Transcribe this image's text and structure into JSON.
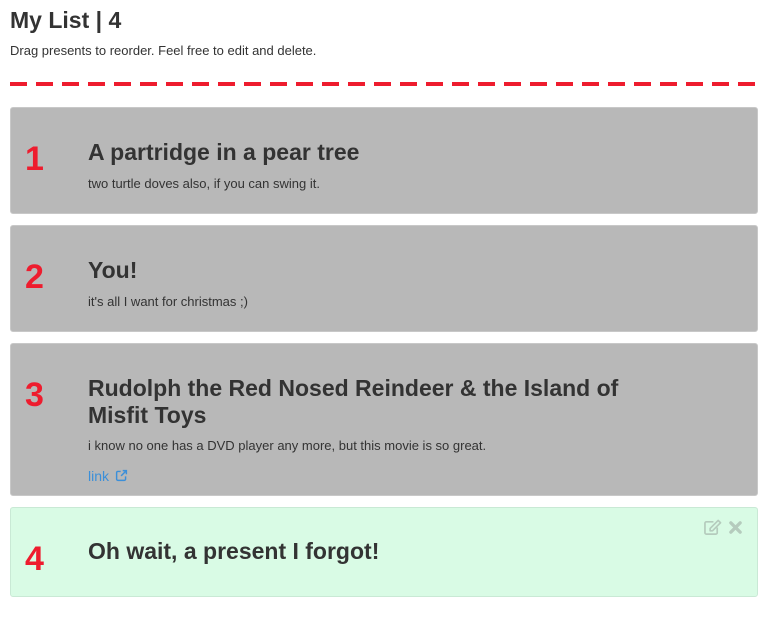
{
  "header": {
    "title": "My List | 4",
    "subtitle": "Drag presents to reorder. Feel free to edit and delete."
  },
  "items": [
    {
      "number": "1",
      "title": "A partridge in a pear tree",
      "description": "two turtle doves also, if you can swing it."
    },
    {
      "number": "2",
      "title": "You!",
      "description": "it's all I want for christmas ;)"
    },
    {
      "number": "3",
      "title": "Rudolph the Red Nosed Reindeer & the Island of Misfit Toys",
      "description": "i know no one has a DVD player any more, but this movie is so great.",
      "link_label": "link"
    },
    {
      "number": "4",
      "title": "Oh wait, a present I forgot!"
    }
  ],
  "colors": {
    "accent_red": "#ee1c2e",
    "item_bg": "#b8b8b8",
    "highlight_bg": "#d9fbe5",
    "link": "#3b8fd9"
  },
  "icons": {
    "external_link": "external-link-icon",
    "edit": "edit-icon",
    "delete": "close-icon"
  }
}
